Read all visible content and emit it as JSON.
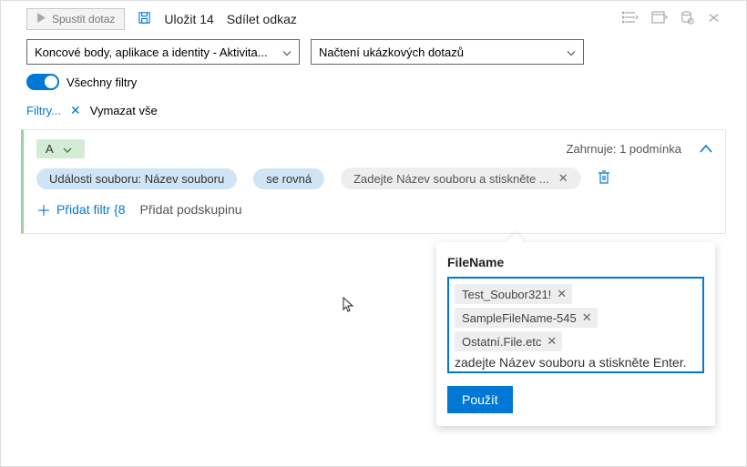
{
  "toolbar": {
    "run_label": "Spustit dotaz",
    "save_label": "Uložit 14",
    "share_label": "Sdílet odkaz"
  },
  "selectors": {
    "scope": "Koncové body, aplikace a identity - Aktivita...",
    "sample": "Načtení ukázkových dotazů"
  },
  "toggle": {
    "label": "Všechny filtry"
  },
  "filter_links": {
    "filters": "Filtry...",
    "clear_all": "Vymazat vše"
  },
  "group": {
    "mode": "A",
    "summary": "Zahrnuje: 1 podmínka",
    "chips": {
      "field": "Události souboru: Název souboru",
      "op": "se rovná",
      "value_placeholder": "Zadejte Název souboru a stiskněte ..."
    },
    "add_filter": "Přidat filtr {8",
    "add_subgroup": "Přidat podskupinu"
  },
  "popup": {
    "title": "FileName",
    "tags": [
      "Test_Soubor321!",
      "SampleFileName-545",
      "Ostatní.File.etc"
    ],
    "hint": "zadejte Název souboru a stiskněte Enter.",
    "apply": "Použít"
  }
}
